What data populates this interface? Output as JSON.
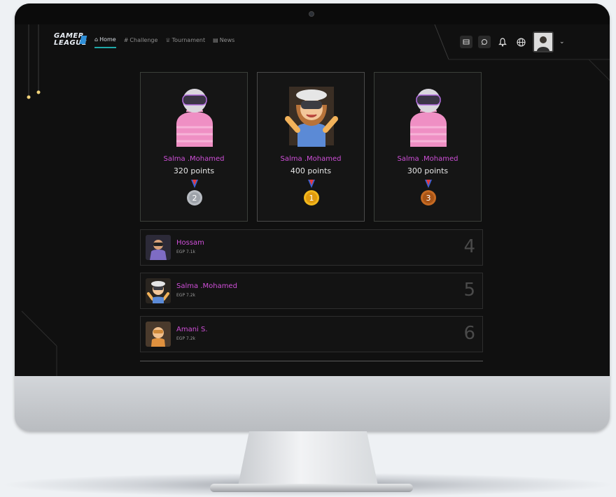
{
  "app": {
    "logo_line1": "GAMER",
    "logo_line2": "LEAGUE"
  },
  "nav": {
    "items": [
      {
        "label": "Home",
        "icon": "home-icon",
        "active": true
      },
      {
        "label": "Challenge",
        "icon": "challenge-icon",
        "active": false
      },
      {
        "label": "Tournament",
        "icon": "trophy-icon",
        "active": false
      },
      {
        "label": "News",
        "icon": "news-icon",
        "active": false
      }
    ]
  },
  "top_actions": [
    "cart-icon",
    "chat-icon",
    "bell-icon",
    "globe-icon",
    "user-avatar",
    "chevron-down-icon"
  ],
  "podium": [
    {
      "rank": 2,
      "name": "Salma .Mohamed",
      "points": "320 points",
      "medal": "2",
      "medal_color": "#b8bcc2"
    },
    {
      "rank": 1,
      "name": "Salma .Mohamed",
      "points": "400 points",
      "medal": "1",
      "medal_color": "#f2b81c"
    },
    {
      "rank": 3,
      "name": "Salma .Mohamed",
      "points": "300 points",
      "medal": "3",
      "medal_color": "#c66a22"
    }
  ],
  "ranking": [
    {
      "name": "Hossam",
      "sub": "EGP 7.1k",
      "rank": "4"
    },
    {
      "name": "Salma .Mohamed",
      "sub": "EGP 7.2k",
      "rank": "5"
    },
    {
      "name": "Amani S.",
      "sub": "EGP 7.2k",
      "rank": "6"
    }
  ],
  "colors": {
    "accent_pink": "#cf4fd8",
    "active_tab": "#1fa8a8",
    "logo_blue": "#2f8fd8"
  }
}
